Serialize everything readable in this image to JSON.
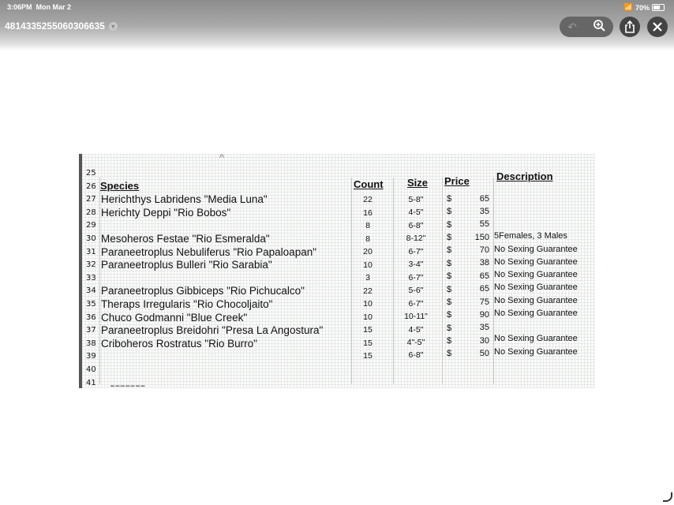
{
  "status": {
    "time": "3:06PM",
    "date": "Mon Mar 2",
    "battery": "70%"
  },
  "title": {
    "text": "4814335255060306635"
  },
  "toolbar": {
    "icons": [
      "markup-back-icon",
      "zoom-in-icon",
      "share-icon",
      "close-icon"
    ]
  },
  "sheet": {
    "column_letter": "A",
    "headers": {
      "species": "Species",
      "count": "Count",
      "size": "Size",
      "price": "Price",
      "description": "Description"
    },
    "rows": [
      {
        "n": "25",
        "species": "",
        "count": "",
        "size": "",
        "dollar": "",
        "price": "",
        "desc": ""
      },
      {
        "n": "26",
        "species": "",
        "count": "",
        "size": "",
        "dollar": "",
        "price": "",
        "desc": ""
      },
      {
        "n": "27",
        "species": "Herichthys Labridens \"Media Luna\"",
        "count": "22",
        "size": "5-8\"",
        "dollar": "$",
        "price": "65",
        "desc": ""
      },
      {
        "n": "28",
        "species": "Herichty Deppi \"Rio Bobos\"",
        "count": "16",
        "size": "4-5\"",
        "dollar": "$",
        "price": "35",
        "desc": ""
      },
      {
        "n": "29",
        "species": "",
        "count": "8",
        "size": "6-8\"",
        "dollar": "$",
        "price": "55",
        "desc": ""
      },
      {
        "n": "30",
        "species": "Mesoheros Festae \"Rio Esmeralda\"",
        "count": "8",
        "size": "8-12\"",
        "dollar": "$",
        "price": "150",
        "desc": "5Females, 3 Males"
      },
      {
        "n": "31",
        "species": "Paraneetroplus Nebuliferus \"Rio Papaloapan\"",
        "count": "20",
        "size": "6-7\"",
        "dollar": "$",
        "price": "70",
        "desc": "No Sexing Guarantee"
      },
      {
        "n": "32",
        "species": "Paraneetroplus Bulleri \"Rio Sarabia\"",
        "count": "10",
        "size": "3-4\"",
        "dollar": "$",
        "price": "38",
        "desc": "No Sexing Guarantee"
      },
      {
        "n": "33",
        "species": "",
        "count": "3",
        "size": "6-7\"",
        "dollar": "$",
        "price": "65",
        "desc": "No Sexing Guarantee"
      },
      {
        "n": "34",
        "species": "Paraneetroplus Gibbiceps \"Rio Pichucalco\"",
        "count": "22",
        "size": "5-6\"",
        "dollar": "$",
        "price": "65",
        "desc": "No Sexing Guarantee"
      },
      {
        "n": "35",
        "species": "Theraps Irregularis \"Rio Chocoljaito\"",
        "count": "10",
        "size": "6-7\"",
        "dollar": "$",
        "price": "75",
        "desc": "No Sexing Guarantee"
      },
      {
        "n": "36",
        "species": "Chuco Godmanni \"Blue Creek\"",
        "count": "10",
        "size": "10-11\"",
        "dollar": "$",
        "price": "90",
        "desc": "No Sexing Guarantee"
      },
      {
        "n": "37",
        "species": "Paraneetroplus Breidohri \"Presa La Angostura\"",
        "count": "15",
        "size": "4-5\"",
        "dollar": "$",
        "price": "35",
        "desc": ""
      },
      {
        "n": "38",
        "species": "Criboheros Rostratus \"Rio Burro\"",
        "count": "15",
        "size": "4\"-5\"",
        "dollar": "$",
        "price": "30",
        "desc": "No Sexing Guarantee"
      },
      {
        "n": "39",
        "species": "",
        "count": "15",
        "size": "6-8\"",
        "dollar": "$",
        "price": "50",
        "desc": "No Sexing Guarantee"
      },
      {
        "n": "40",
        "species": "",
        "count": "",
        "size": "",
        "dollar": "",
        "price": "",
        "desc": ""
      },
      {
        "n": "41",
        "species": "",
        "count": "",
        "size": "",
        "dollar": "",
        "price": "",
        "desc": ""
      }
    ]
  }
}
